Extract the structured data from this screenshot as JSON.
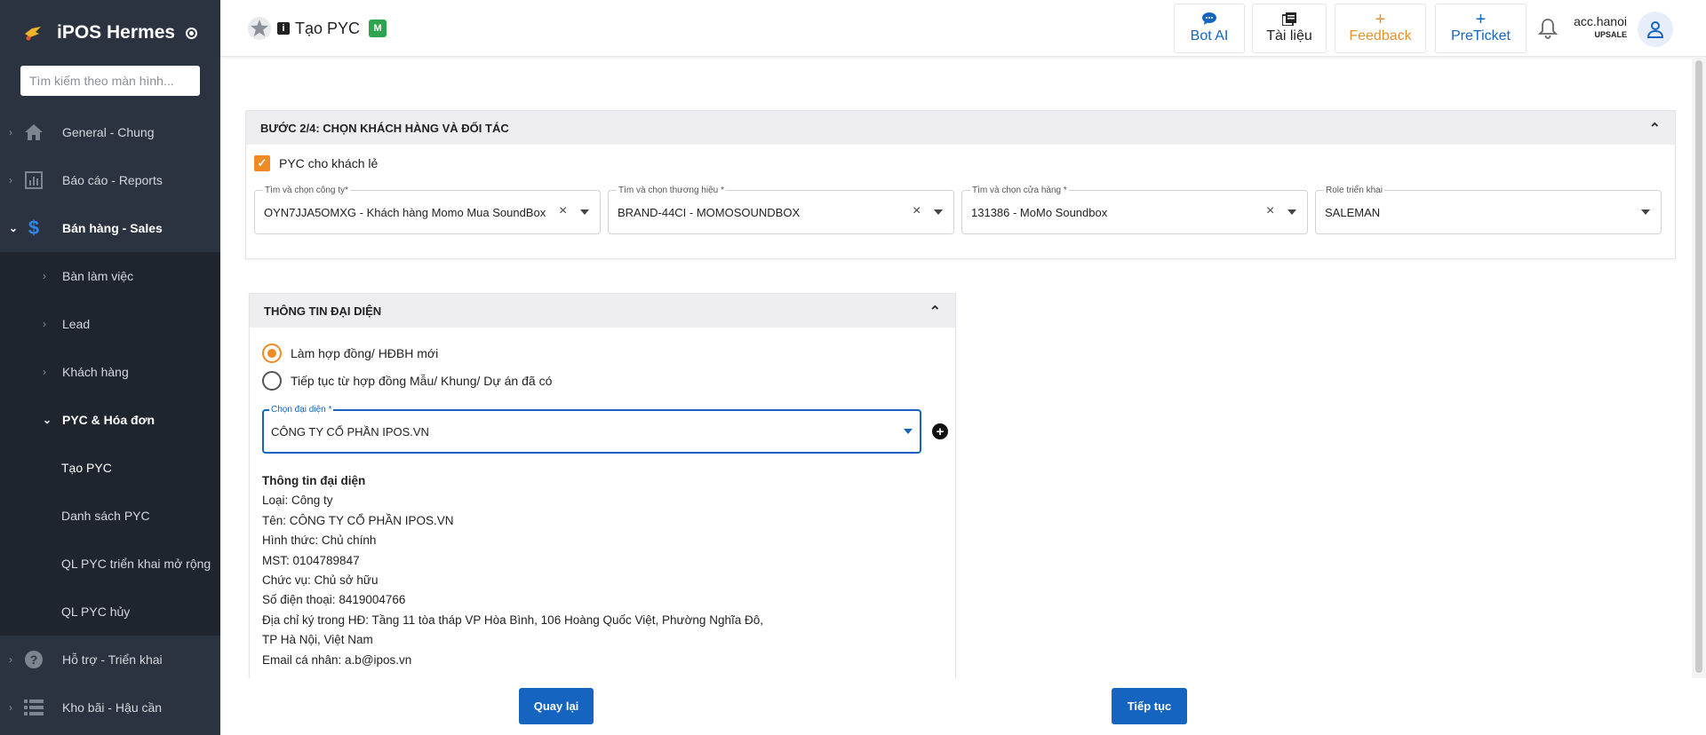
{
  "sidebar": {
    "brand": "iPOS Hermes",
    "search_placeholder": "Tìm kiếm theo màn hình...",
    "items": [
      {
        "label": "General - Chung"
      },
      {
        "label": "Báo cáo - Reports"
      },
      {
        "label": "Bán hàng - Sales"
      },
      {
        "label": "Bàn làm việc"
      },
      {
        "label": "Lead"
      },
      {
        "label": "Khách hàng"
      },
      {
        "label": "PYC & Hóa đơn"
      },
      {
        "label": "Tạo PYC"
      },
      {
        "label": "Danh sách PYC"
      },
      {
        "label": "QL PYC triển khai mở rộng"
      },
      {
        "label": "QL PYC hủy"
      },
      {
        "label": "Hỗ trợ - Triển khai"
      },
      {
        "label": "Kho bãi - Hậu cần"
      }
    ]
  },
  "header": {
    "title": "Tạo PYC",
    "info_glyph": "i",
    "badge": "M",
    "buttons": {
      "bot": "Bot AI",
      "docs": "Tài liệu",
      "feedback": "Feedback",
      "preticket": "PreTicket"
    },
    "user": {
      "name": "acc.hanoi",
      "role": "UPSALE"
    }
  },
  "step": {
    "title": "BƯỚC 2/4: CHỌN KHÁCH HÀNG VÀ ĐỐI TÁC",
    "retail_checkbox": "PYC cho khách lẻ",
    "fields": {
      "company": {
        "label": "Tìm và chọn công ty*",
        "value": "OYN7JJA5OMXG - Khách hàng Momo Mua SoundBox"
      },
      "brand": {
        "label": "Tìm và chọn thương hiệu *",
        "value": "BRAND-44CI - MOMOSOUNDBOX"
      },
      "store": {
        "label": "Tìm và chọn cửa hàng *",
        "value": "131386 - MoMo Soundbox"
      },
      "role": {
        "label": "Role triển khai",
        "value": "SALEMAN"
      }
    }
  },
  "rep": {
    "title": "THÔNG TIN ĐẠI DIỆN",
    "radio_new": "Làm hợp đồng/ HĐBH mới",
    "radio_continue": "Tiếp tục từ hợp đồng Mẫu/ Khung/ Dự án đã có",
    "select_label": "Chọn đại diện *",
    "select_value": "CÔNG TY CỔ PHẦN IPOS.VN",
    "add_glyph": "+",
    "info": {
      "heading": "Thông tin đại diện",
      "type": "Loại: Công ty",
      "name": "Tên: CÔNG TY CỔ PHẦN IPOS.VN",
      "form": "Hình thức: Chủ chính",
      "tax": "MST: 0104789847",
      "position": "Chức vụ: Chủ sở hữu",
      "phone": "Số điện thoại: 8419004766",
      "address1": "Địa chỉ ký trong HĐ: Tầng 11 tòa tháp VP Hòa Bình, 106 Hoàng Quốc Việt, Phường Nghĩa Đô,",
      "address2": "TP Hà Nội, Việt Nam",
      "email": "Email cá nhân: a.b@ipos.vn"
    }
  },
  "actions": {
    "back": "Quay lại",
    "next": "Tiếp tục"
  },
  "colors": {
    "sidebar": "#2b3240",
    "primary": "#1565c0",
    "accent": "#ef8b22"
  }
}
